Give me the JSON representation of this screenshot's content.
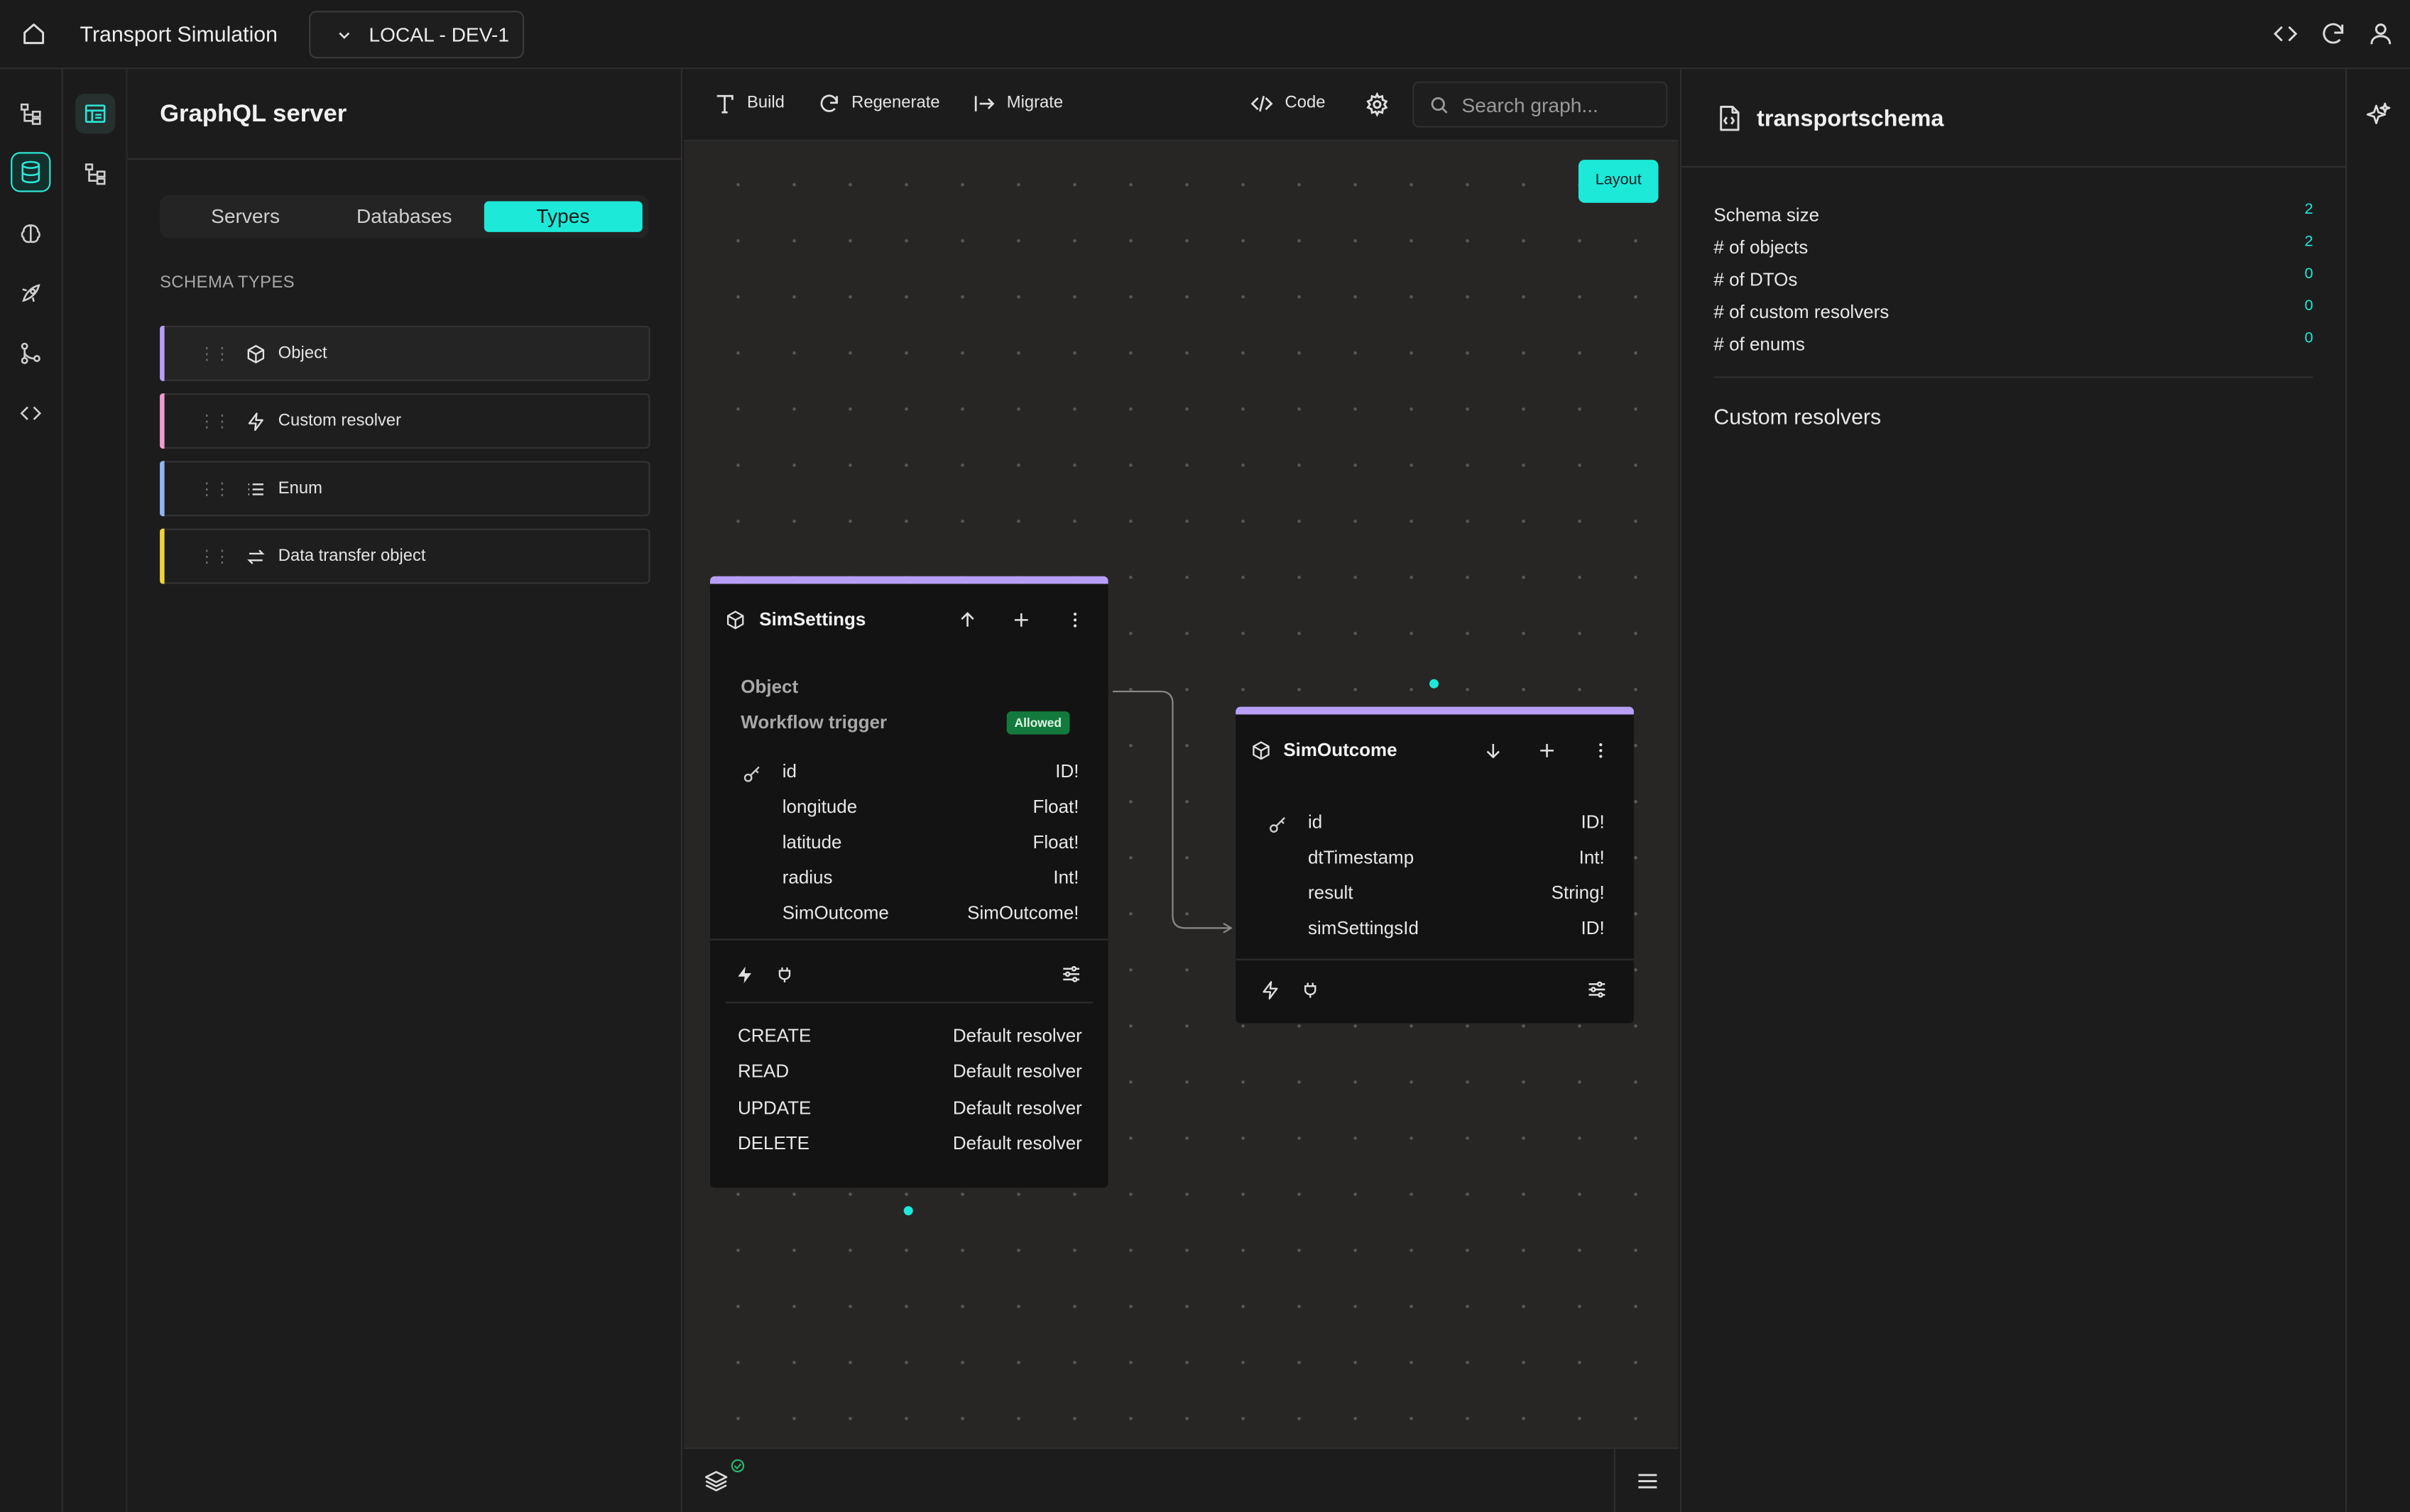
{
  "app": {
    "title": "Transport Simulation",
    "environment": "LOCAL - DEV-1"
  },
  "left_panel": {
    "title": "GraphQL server",
    "tabs": [
      "Servers",
      "Databases",
      "Types"
    ],
    "active_tab": "Types",
    "section_label": "SCHEMA TYPES",
    "types": [
      {
        "label": "Object",
        "icon": "cube-icon",
        "color": "#b79ff8"
      },
      {
        "label": "Custom resolver",
        "icon": "lightning-icon",
        "color": "#f29bd0"
      },
      {
        "label": "Enum",
        "icon": "list-icon",
        "color": "#8fb6f5"
      },
      {
        "label": "Data transfer object",
        "icon": "swap-icon",
        "color": "#f0d33c"
      }
    ]
  },
  "toolbar": {
    "build": "Build",
    "regenerate": "Regenerate",
    "migrate": "Migrate",
    "code": "Code",
    "search_placeholder": "Search graph..."
  },
  "canvas": {
    "layout_button": "Layout",
    "nodes": {
      "sim_settings": {
        "name": "SimSettings",
        "kind": "Object",
        "workflow_label": "Workflow trigger",
        "workflow_status": "Allowed",
        "fields": [
          {
            "name": "id",
            "type": "ID!",
            "key": true
          },
          {
            "name": "longitude",
            "type": "Float!"
          },
          {
            "name": "latitude",
            "type": "Float!"
          },
          {
            "name": "radius",
            "type": "Int!"
          },
          {
            "name": "SimOutcome",
            "type": "SimOutcome!"
          }
        ],
        "resolvers": [
          {
            "op": "CREATE",
            "resolver": "Default resolver"
          },
          {
            "op": "READ",
            "resolver": "Default resolver"
          },
          {
            "op": "UPDATE",
            "resolver": "Default resolver"
          },
          {
            "op": "DELETE",
            "resolver": "Default resolver"
          }
        ]
      },
      "sim_outcome": {
        "name": "SimOutcome",
        "fields": [
          {
            "name": "id",
            "type": "ID!",
            "key": true
          },
          {
            "name": "dtTimestamp",
            "type": "Int!"
          },
          {
            "name": "result",
            "type": "String!"
          },
          {
            "name": "simSettingsId",
            "type": "ID!"
          }
        ]
      }
    }
  },
  "right_panel": {
    "title": "transportschema",
    "stats": [
      {
        "label": "Schema size",
        "value": "2"
      },
      {
        "label": "# of objects",
        "value": "2"
      },
      {
        "label": "# of DTOs",
        "value": "0"
      },
      {
        "label": "# of custom resolvers",
        "value": "0"
      },
      {
        "label": "# of enums",
        "value": "0"
      }
    ],
    "section_title": "Custom resolvers"
  },
  "colors": {
    "accent": "#1de9d9",
    "object": "#b79ff8",
    "allowed": "#137a3d"
  }
}
